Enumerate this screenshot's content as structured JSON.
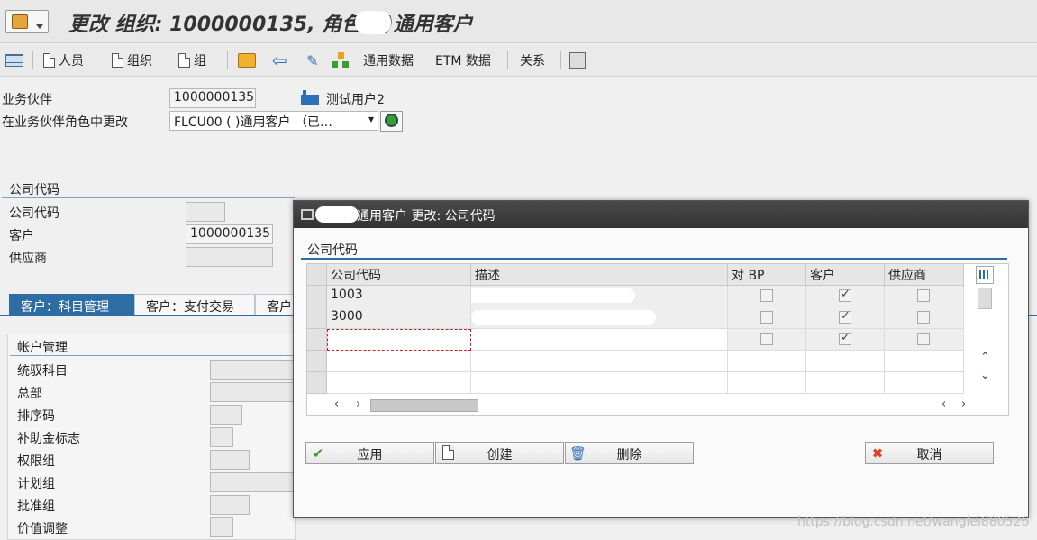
{
  "window": {
    "title": "更改 组织: 1000000135, 角色 (  )通用客户"
  },
  "toolbar": {
    "person_label": "人员",
    "org_label": "组织",
    "group_label": "组",
    "general_data_label": "通用数据",
    "etm_data_label": "ETM 数据",
    "relations_label": "关系"
  },
  "header": {
    "bp_label": "业务伙伴",
    "bp_value": "1000000135",
    "bp_name": "测试用户2",
    "role_label": "在业务伙伴角色中更改",
    "role_value": "FLCU00 (  )通用客户 （已…"
  },
  "company_section": {
    "title": "公司代码",
    "company_code_label": "公司代码",
    "customer_label": "客户",
    "customer_value": "1000000135",
    "vendor_label": "供应商"
  },
  "tabs": [
    {
      "label": "客户：科目管理",
      "active": true
    },
    {
      "label": "客户：支付交易",
      "active": false
    },
    {
      "label": "客户",
      "active": false
    }
  ],
  "account_section": {
    "title": "帐户管理",
    "fields": [
      "统驭科目",
      "总部",
      "排序码",
      "补助金标志",
      "权限组",
      "计划组",
      "批准组",
      "价值调整"
    ]
  },
  "dialog": {
    "title": "通用客户 更改: 公司代码",
    "section_title": "公司代码",
    "columns": [
      "公司代码",
      "描述",
      "对 BP",
      "客户",
      "供应商"
    ],
    "rows": [
      {
        "code": "1003",
        "desc": "",
        "bp": false,
        "customer": true,
        "vendor": false
      },
      {
        "code": "3000",
        "desc": "",
        "bp": false,
        "customer": true,
        "vendor": false
      },
      {
        "code": "",
        "desc": "",
        "bp": false,
        "customer": true,
        "vendor": false
      }
    ],
    "buttons": {
      "apply": "应用",
      "create": "创建",
      "delete": "删除",
      "cancel": "取消"
    }
  },
  "watermark": "https://blog.csdn.net/wanglei880526",
  "colors": {
    "accent": "#2e6ca4",
    "dialog_title_bg": "#3a3a3a",
    "cancel_icon": "#d9412b",
    "apply_icon": "#3a9d2f"
  }
}
